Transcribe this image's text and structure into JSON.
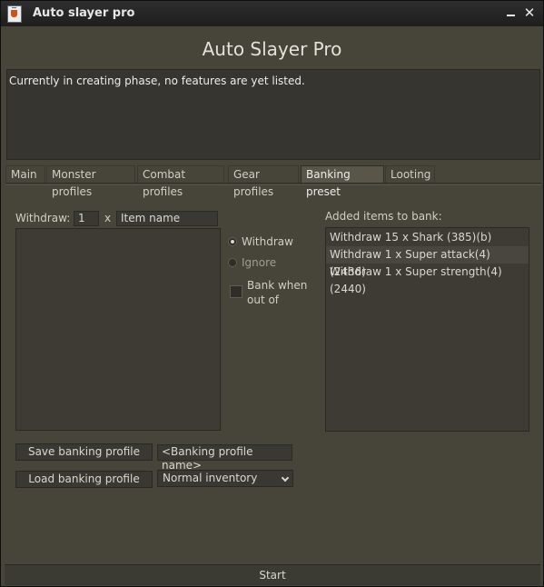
{
  "window": {
    "title": "Auto slayer pro"
  },
  "app": {
    "title": "Auto Slayer Pro",
    "description": "Currently in creating phase, no features are yet listed."
  },
  "tabs": [
    {
      "label": "Main",
      "active": false
    },
    {
      "label": "Monster profiles",
      "active": false
    },
    {
      "label": "Combat profiles",
      "active": false
    },
    {
      "label": "Gear profiles",
      "active": false
    },
    {
      "label": "Banking preset",
      "active": true
    },
    {
      "label": "Looting",
      "active": false
    }
  ],
  "banking": {
    "withdraw_label": "Withdraw:",
    "quantity_value": "1",
    "times_label": "x",
    "item_name_value": "Item name",
    "mode_options": [
      {
        "label": "Withdraw",
        "selected": true
      },
      {
        "label": "Ignore",
        "selected": false
      }
    ],
    "bank_when_out_label": "Bank when out of",
    "bank_when_out_checked": false,
    "added_items_label": "Added items to bank:",
    "added_items": [
      "Withdraw 15 x Shark (385)(b)",
      "Withdraw 1 x Super attack(4) (2436)",
      "Withdraw 1 x Super strength(4) (2440)"
    ],
    "save_button_label": "Save banking profile",
    "profile_name_value": "<Banking profile name>",
    "load_button_label": "Load banking profile",
    "inventory_select_value": "Normal inventory"
  },
  "footer": {
    "start_label": "Start"
  },
  "icons": {
    "app": "java-app-icon",
    "minimize": "minimize-icon",
    "close": "close-icon",
    "dropdown": "chevron-down-icon"
  }
}
